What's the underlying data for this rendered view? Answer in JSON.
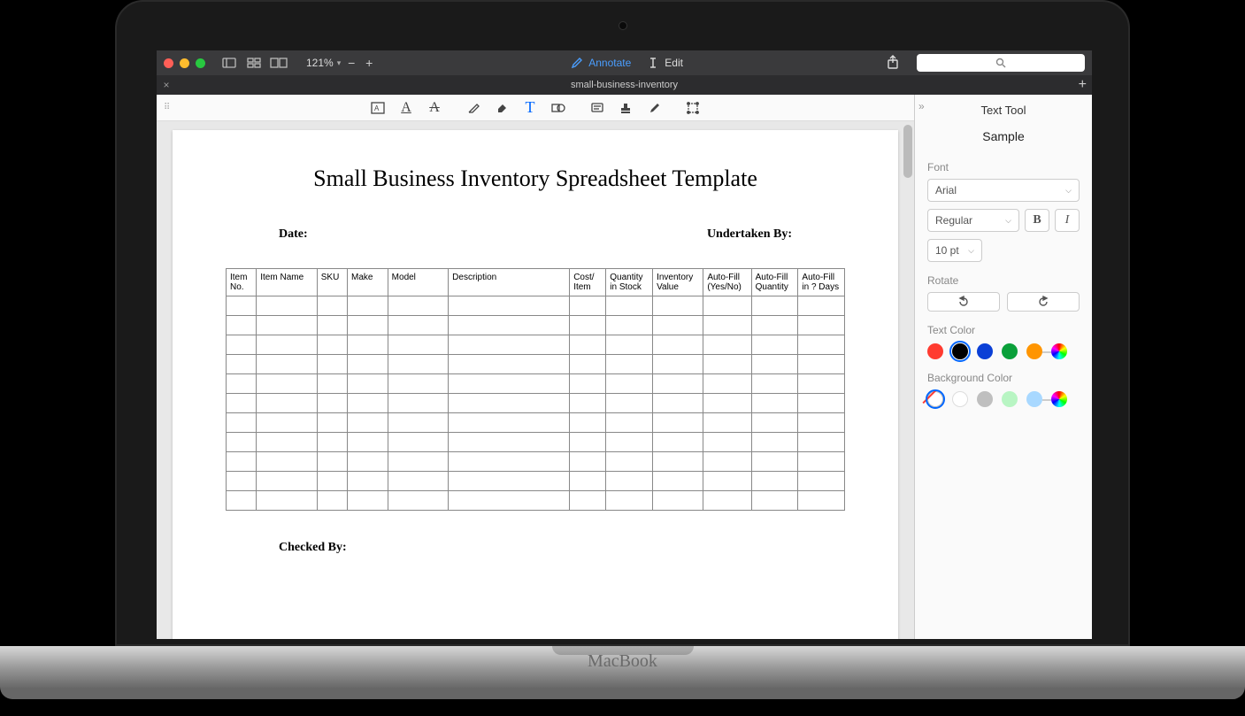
{
  "toolbar": {
    "zoom": "121%",
    "annotate": "Annotate",
    "edit": "Edit"
  },
  "tab": {
    "title": "small-business-inventory"
  },
  "document": {
    "title": "Small Business Inventory Spreadsheet Template",
    "date_label": "Date:",
    "undertaken_label": "Undertaken By:",
    "checked_label": "Checked By:",
    "columns": [
      "Item No.",
      "Item Name",
      "SKU",
      "Make",
      "Model",
      "Description",
      "Cost/ Item",
      "Quantity in Stock",
      "Inventory Value",
      "Auto-Fill (Yes/No)",
      "Auto-Fill Quantity",
      "Auto-Fill in ? Days"
    ],
    "empty_rows": 11
  },
  "inspector": {
    "title": "Text Tool",
    "sample": "Sample",
    "font_label": "Font",
    "font_value": "Arial",
    "weight_value": "Regular",
    "bold": "B",
    "italic": "I",
    "size_value": "10 pt",
    "rotate_label": "Rotate",
    "text_color_label": "Text Color",
    "bg_color_label": "Background Color",
    "text_colors": [
      "#ff3b30",
      "#000000",
      "#0a3fd6",
      "#0aa03a",
      "#ff9500"
    ],
    "text_color_selected": 1,
    "bg_colors_plain": [
      "#ffffff",
      "#bfbfbf",
      "#b8f5c3",
      "#a8d8ff"
    ],
    "bg_selected_none": true
  },
  "laptop": {
    "brand": "MacBook"
  }
}
